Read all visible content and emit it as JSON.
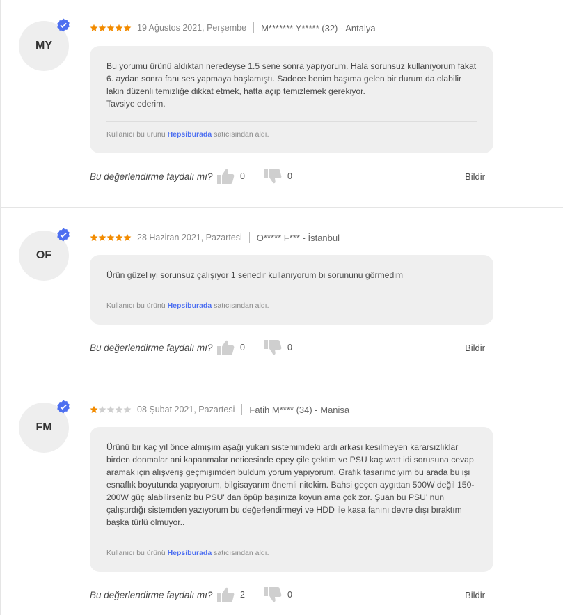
{
  "colors": {
    "star": "#f28b00",
    "star_empty": "#cfcfcf",
    "verified": "#4d6ff0",
    "link": "#4d6ff0"
  },
  "reviews": [
    {
      "initials": "MY",
      "rating": 5,
      "date": "19 Ağustos 2021, Perşembe",
      "user": "M******* Y***** (32) - Antalya",
      "text": "Bu yorumu ürünü aldıktan neredeyse 1.5 sene sonra yapıyorum. Hala sorunsuz kullanıyorum fakat 6. aydan sonra fanı ses yapmaya başlamıştı. Sadece benim başıma gelen bir durum da olabilir lakin düzenli temizliğe dikkat etmek, hatta açıp temizlemek gerekiyor.\nTavsiye ederim.",
      "seller_prefix": "Kullanıcı bu ürünü",
      "seller_name": "Hepsiburada",
      "seller_suffix": "satıcısından aldı.",
      "helpful_question": "Bu değerlendirme faydalı mı?",
      "likes": "0",
      "dislikes": "0",
      "report_label": "Bildir"
    },
    {
      "initials": "OF",
      "rating": 5,
      "date": "28 Haziran 2021, Pazartesi",
      "user": "O***** F*** - İstanbul",
      "text": "Ürün güzel iyi sorunsuz çalışıyor 1 senedir kullanıyorum bi sorununu görmedim",
      "seller_prefix": "Kullanıcı bu ürünü",
      "seller_name": "Hepsiburada",
      "seller_suffix": "satıcısından aldı.",
      "helpful_question": "Bu değerlendirme faydalı mı?",
      "likes": "0",
      "dislikes": "0",
      "report_label": "Bildir"
    },
    {
      "initials": "FM",
      "rating": 1,
      "date": "08 Şubat 2021, Pazartesi",
      "user": "Fatih M**** (34) - Manisa",
      "text": "Ürünü bir kaç yıl önce almışım aşağı yukarı sistemimdeki ardı arkası kesilmeyen kararsızlıklar birden donmalar ani kapanmalar neticesinde epey çile çektim ve PSU kaç watt idi sorusuna cevap aramak için alışveriş geçmişimden buldum yorum yapıyorum. Grafik tasarımcıyım bu arada bu işi esnaflık boyutunda yapıyorum, bilgisayarım önemli nitekim. Bahsi geçen aygıttan 500W değil 150-200W güç alabilirseniz bu PSU' dan öpüp başınıza koyun ama çok zor. Şuan bu PSU' nun çalıştırdığı sistemden yazıyorum bu değerlendirmeyi ve HDD ile kasa fanını devre dışı bıraktım başka türlü olmuyor..",
      "seller_prefix": "Kullanıcı bu ürünü",
      "seller_name": "Hepsiburada",
      "seller_suffix": "satıcısından aldı.",
      "helpful_question": "Bu değerlendirme faydalı mı?",
      "likes": "2",
      "dislikes": "0",
      "report_label": "Bildir"
    }
  ]
}
